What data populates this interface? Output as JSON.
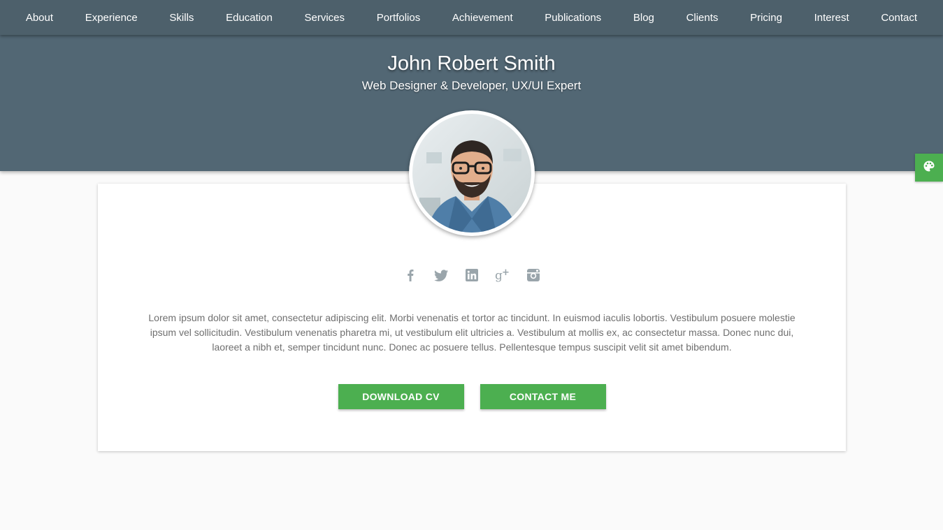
{
  "nav": {
    "items": [
      {
        "label": "About"
      },
      {
        "label": "Experience"
      },
      {
        "label": "Skills"
      },
      {
        "label": "Education"
      },
      {
        "label": "Services"
      },
      {
        "label": "Portfolios"
      },
      {
        "label": "Achievement"
      },
      {
        "label": "Publications"
      },
      {
        "label": "Blog"
      },
      {
        "label": "Clients"
      },
      {
        "label": "Pricing"
      },
      {
        "label": "Interest"
      },
      {
        "label": "Contact"
      }
    ]
  },
  "hero": {
    "name": "John Robert Smith",
    "title": "Web Designer & Developer, UX/UI Expert"
  },
  "profile": {
    "social_icons": [
      "facebook-icon",
      "twitter-icon",
      "linkedin-icon",
      "google-plus-icon",
      "instagram-icon"
    ],
    "bio": "Lorem ipsum dolor sit amet, consectetur adipiscing elit. Morbi venenatis et tortor ac tincidunt. In euismod iaculis lobortis. Vestibulum posuere molestie ipsum vel sollicitudin. Vestibulum venenatis pharetra mi, ut vestibulum elit ultricies a. Vestibulum at mollis ex, ac consectetur massa. Donec nunc dui, laoreet a nibh et, semper tincidunt nunc. Donec ac posuere tellus. Pellentesque tempus suscipit velit sit amet bibendum.",
    "download_label": "DOWNLOAD CV",
    "contact_label": "CONTACT ME"
  },
  "colors": {
    "nav_bg": "#4d606b",
    "hero_bg": "#526774",
    "accent": "#4caf50",
    "icon_gray": "#9aa5ab"
  },
  "widgets": {
    "theme_switcher_icon": "palette-icon"
  }
}
